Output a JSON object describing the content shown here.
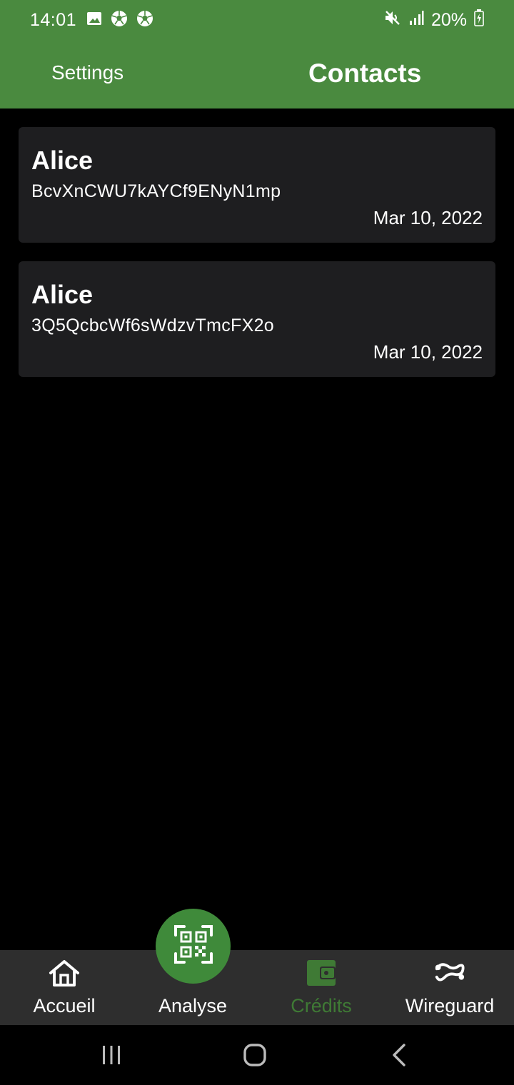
{
  "status_bar": {
    "time": "14:01",
    "left_icons": [
      "gallery-icon",
      "soccer-ball-icon",
      "soccer-ball-icon"
    ],
    "battery_percent": "20%",
    "right_icons": [
      "mute-icon",
      "signal-icon",
      "battery-charging-icon"
    ]
  },
  "header": {
    "settings_label": "Settings",
    "title": "Contacts",
    "color": "#4a8a3f"
  },
  "contacts": [
    {
      "name": "Alice",
      "id": "BcvXnCWU7kAYCf9ENyN1mp",
      "date": "Mar 10, 2022"
    },
    {
      "name": "Alice",
      "id": "3Q5QcbcWf6sWdzvTmcFX2o",
      "date": "Mar 10, 2022"
    }
  ],
  "bottom_nav": {
    "items": [
      {
        "label": "Accueil",
        "icon": "home-icon",
        "active": false
      },
      {
        "label": "Analyse",
        "icon": "qr-scan-icon",
        "active": false
      },
      {
        "label": "Crédits",
        "icon": "wallet-icon",
        "active": true
      },
      {
        "label": "Wireguard",
        "icon": "wireguard-icon",
        "active": false
      }
    ],
    "active_color": "#3f7a35"
  },
  "system_nav": {
    "buttons": [
      "recents-icon",
      "home-circle-icon",
      "back-icon"
    ]
  }
}
